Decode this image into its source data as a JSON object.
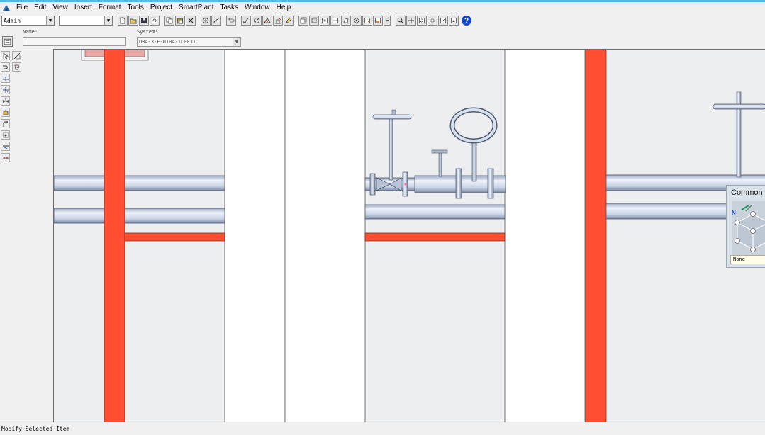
{
  "menu": [
    "File",
    "Edit",
    "View",
    "Insert",
    "Format",
    "Tools",
    "Project",
    "SmartPlant",
    "Tasks",
    "Window",
    "Help"
  ],
  "toolbar": {
    "user_combo": "Admin",
    "second_combo": "",
    "help_label": "?"
  },
  "fields": {
    "name_label": "Name:",
    "name_value": "",
    "system_label": "System:",
    "system_value": "U04-3-F-0104-1C0031"
  },
  "common_views": {
    "title": "Common",
    "none_label": "None",
    "axis_n_label": "N"
  },
  "status": {
    "text": "Modify Selected Item"
  },
  "colors": {
    "pipe": "#c9d5ea",
    "steel_column": "#ff4e31",
    "viewport_bg": "#eceef0",
    "accent": "#5bb8e6"
  }
}
